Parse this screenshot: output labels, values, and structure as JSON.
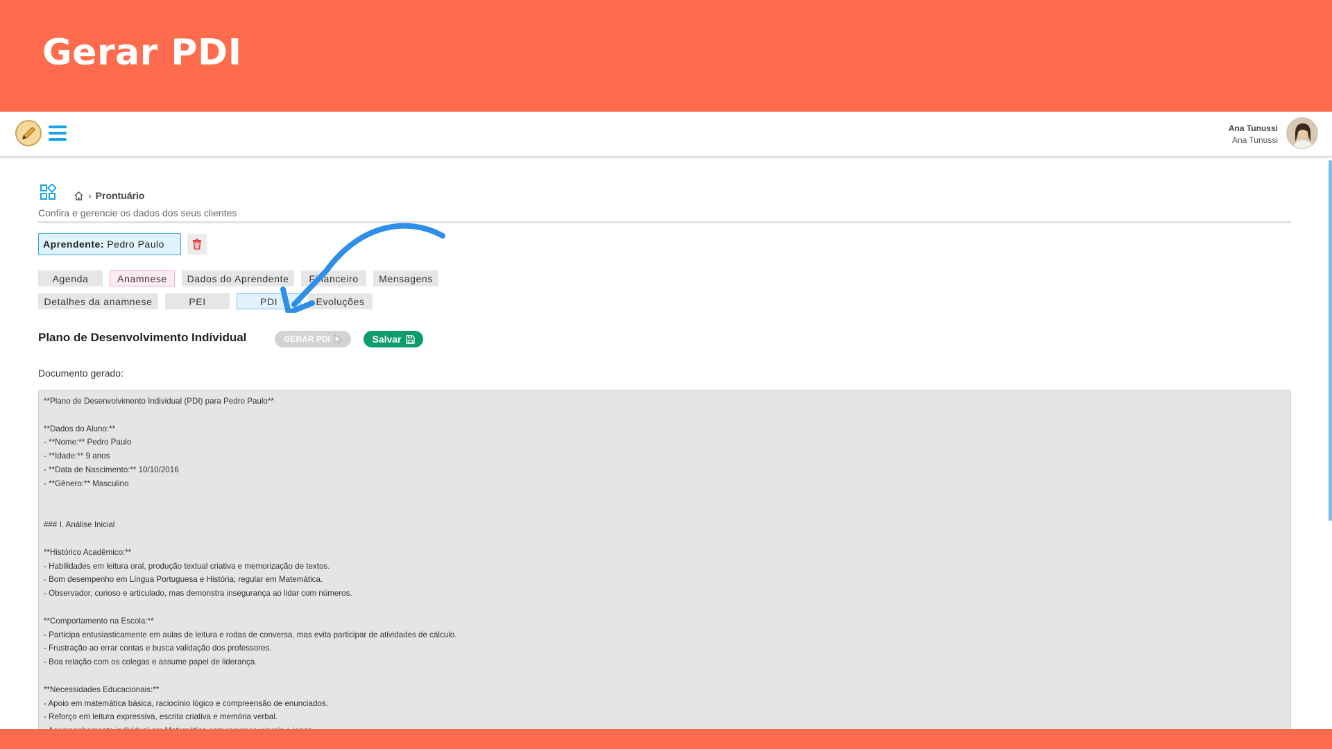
{
  "banner": {
    "title": "Gerar PDI"
  },
  "header": {
    "user_name": "Ana Tunussi",
    "user_role": "Ana Tunussi"
  },
  "breadcrumb": {
    "current": "Prontuário"
  },
  "page": {
    "subtitle": "Confira e gerencie os dados dos seus clientes"
  },
  "learner": {
    "label": "Aprendente:",
    "name": "Pedro Paulo"
  },
  "tabs": {
    "agenda": "Agenda",
    "anamnese": "Anamnese",
    "dados": "Dados do Aprendente",
    "financeiro": "Financeiro",
    "mensagens": "Mensagens",
    "detalhes": "Detalhes da anamnese",
    "pei": "PEI",
    "pdi": "PDI",
    "evolucoes": "Evoluções"
  },
  "section": {
    "title": "Plano de Desenvolvimento Individual",
    "generate_label": "GERAR PDI",
    "save_label": "Salvar"
  },
  "document": {
    "label": "Documento gerado:",
    "content": "**Plano de Desenvolvimento Individual (PDI) para Pedro Paulo**\n\n**Dados do Aluno:**\n- **Nome:** Pedro Paulo\n- **Idade:** 9 anos\n- **Data de Nascimento:** 10/10/2016\n- **Gênero:** Masculino\n\n\n### I. Análise Inicial\n\n**Histórico Acadêmico:**\n- Habilidades em leitura oral, produção textual criativa e memorização de textos.\n- Bom desempenho em Língua Portuguesa e História; regular em Matemática.\n- Observador, curioso e articulado, mas demonstra insegurança ao lidar com números.\n\n**Comportamento na Escola:**\n- Participa entusiasticamente em aulas de leitura e rodas de conversa, mas evita participar de atividades de cálculo.\n- Frustração ao errar contas e busca validação dos professores.\n- Boa relação com os colegas e assume papel de liderança.\n\n**Necessidades Educacionais:**\n- Apoio em matemática básica, raciocínio lógico e compreensão de enunciados.\n- Reforço em leitura expressiva, escrita criativa e memória verbal.\n- Acompanhamento individual em Matemática com recursos visuais e jogos."
  },
  "colors": {
    "banner": "#ff6b4d",
    "accent_blue": "#1aa3e8",
    "save_green": "#0f9b6e",
    "delete_red": "#e53935"
  }
}
